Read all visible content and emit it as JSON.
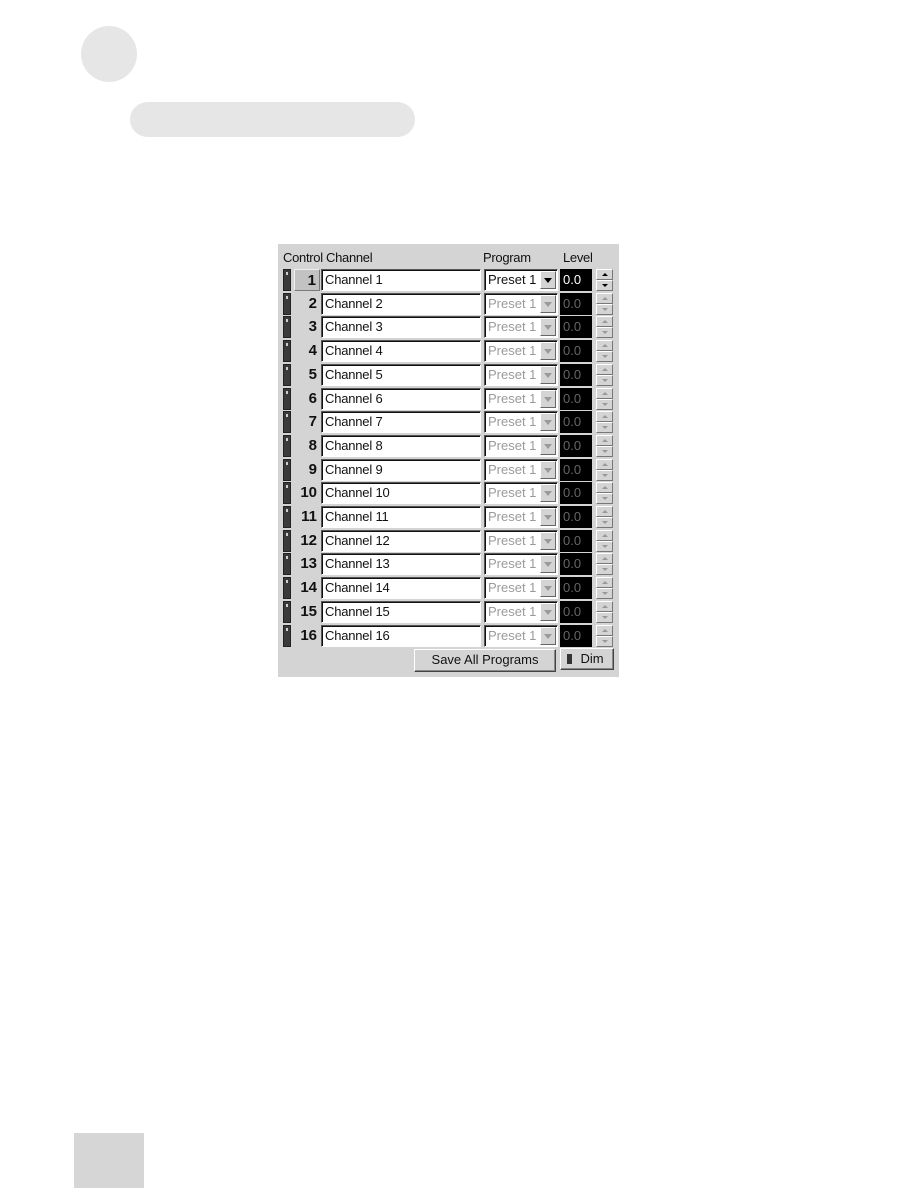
{
  "headers": {
    "control": "Control",
    "channel": "Channel",
    "program": "Program",
    "level": "Level"
  },
  "selected_channel": 1,
  "channels": [
    {
      "number": "1",
      "name": "Channel 1",
      "program": "Preset 1",
      "level": "0.0",
      "enabled": true
    },
    {
      "number": "2",
      "name": "Channel 2",
      "program": "Preset 1",
      "level": "0.0",
      "enabled": false
    },
    {
      "number": "3",
      "name": "Channel 3",
      "program": "Preset 1",
      "level": "0.0",
      "enabled": false
    },
    {
      "number": "4",
      "name": "Channel 4",
      "program": "Preset 1",
      "level": "0.0",
      "enabled": false
    },
    {
      "number": "5",
      "name": "Channel 5",
      "program": "Preset 1",
      "level": "0.0",
      "enabled": false
    },
    {
      "number": "6",
      "name": "Channel 6",
      "program": "Preset 1",
      "level": "0.0",
      "enabled": false
    },
    {
      "number": "7",
      "name": "Channel 7",
      "program": "Preset 1",
      "level": "0.0",
      "enabled": false
    },
    {
      "number": "8",
      "name": "Channel 8",
      "program": "Preset 1",
      "level": "0.0",
      "enabled": false
    },
    {
      "number": "9",
      "name": "Channel 9",
      "program": "Preset 1",
      "level": "0.0",
      "enabled": false
    },
    {
      "number": "10",
      "name": "Channel 10",
      "program": "Preset 1",
      "level": "0.0",
      "enabled": false
    },
    {
      "number": "11",
      "name": "Channel 11",
      "program": "Preset 1",
      "level": "0.0",
      "enabled": false
    },
    {
      "number": "12",
      "name": "Channel 12",
      "program": "Preset 1",
      "level": "0.0",
      "enabled": false
    },
    {
      "number": "13",
      "name": "Channel 13",
      "program": "Preset 1",
      "level": "0.0",
      "enabled": false
    },
    {
      "number": "14",
      "name": "Channel 14",
      "program": "Preset 1",
      "level": "0.0",
      "enabled": false
    },
    {
      "number": "15",
      "name": "Channel 15",
      "program": "Preset 1",
      "level": "0.0",
      "enabled": false
    },
    {
      "number": "16",
      "name": "Channel 16",
      "program": "Preset 1",
      "level": "0.0",
      "enabled": false
    }
  ],
  "buttons": {
    "save_all": "Save All Programs",
    "dim": "Dim"
  },
  "colors": {
    "panel_bg": "#d4d4d4",
    "level_bg": "#000000",
    "disabled_text": "#9a9a9a"
  }
}
